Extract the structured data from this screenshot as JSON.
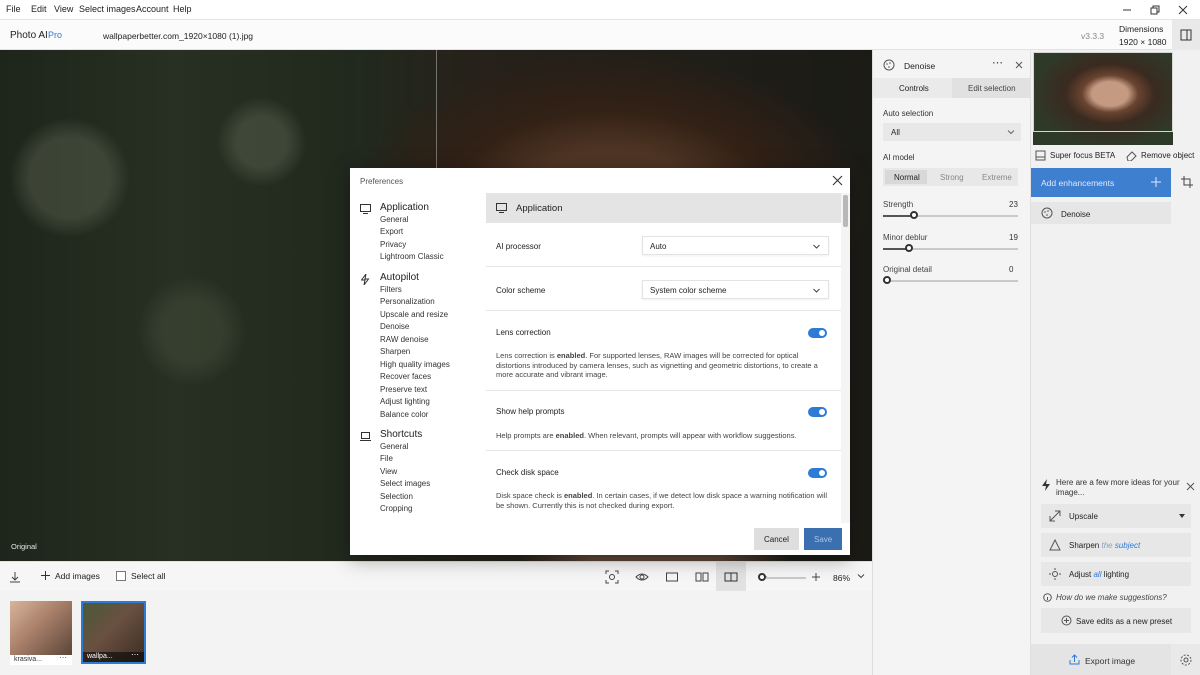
{
  "menu": {
    "file": "File",
    "edit": "Edit",
    "view": "View",
    "select_images": "Select images",
    "account": "Account",
    "help": "Help"
  },
  "header": {
    "app_name": "Photo AI",
    "app_tier": "Pro",
    "file_name": "wallpaperbetter.com_1920×1080 (1).jpg",
    "version": "v3.3.3",
    "dimensions_label": "Dimensions",
    "dimensions_value": "1920 × 1080"
  },
  "canvas": {
    "original_label": "Original"
  },
  "bottombar": {
    "add_images": "Add images",
    "select_all": "Select all",
    "zoom": "86%"
  },
  "filmstrip": {
    "items": [
      {
        "label": "krasiva..."
      },
      {
        "label": "wallpa..."
      }
    ]
  },
  "denoise_panel": {
    "title": "Denoise",
    "tabs": [
      "Controls",
      "Edit selection"
    ],
    "auto_selection_label": "Auto selection",
    "auto_selection_value": "All",
    "ai_model_label": "AI model",
    "models": [
      "Normal",
      "Strong",
      "Extreme"
    ],
    "sliders": [
      {
        "label": "Strength",
        "value": "23",
        "level": 0.23
      },
      {
        "label": "Minor deblur",
        "value": "19",
        "level": 0.19
      },
      {
        "label": "Original detail",
        "value": "0",
        "level": 0.0
      }
    ]
  },
  "side": {
    "super_focus": "Super focus BETA",
    "remove_object": "Remove object",
    "add_enhancements": "Add enhancements",
    "enhancement_item": "Denoise",
    "ideas_text": "Here are a few more ideas for your image...",
    "upscale": "Upscale",
    "sharpen_prefix": "Sharpen",
    "sharpen_the": "the",
    "sharpen_subject": "subject",
    "adjust_prefix": "Adjust",
    "adjust_all": "all",
    "adjust_suffix": "lighting",
    "how_suggestions": "How do we make suggestions?",
    "save_preset": "Save edits as a new preset",
    "export": "Export image"
  },
  "modal": {
    "title": "Preferences",
    "nav": [
      {
        "heading": "Application",
        "items": [
          "General",
          "Export",
          "Privacy",
          "Lightroom Classic"
        ]
      },
      {
        "heading": "Autopilot",
        "items": [
          "Filters",
          "Personalization",
          "Upscale and resize",
          "Denoise",
          "RAW denoise",
          "Sharpen",
          "High quality images",
          "Recover faces",
          "Preserve text",
          "Adjust lighting",
          "Balance color"
        ]
      },
      {
        "heading": "Shortcuts",
        "items": [
          "General",
          "File",
          "View",
          "Select images",
          "Selection",
          "Cropping"
        ]
      }
    ],
    "section_title": "Application",
    "ai_processor_label": "AI processor",
    "ai_processor_value": "Auto",
    "color_scheme_label": "Color scheme",
    "color_scheme_value": "System color scheme",
    "lens": {
      "label": "Lens correction",
      "desc_a": "Lens correction is ",
      "desc_b": "enabled",
      "desc_c": ". For supported lenses, RAW images will be corrected for optical distortions introduced by camera lenses, such as vignetting and geometric distortions, to create a more accurate and vibrant image."
    },
    "help": {
      "label": "Show help prompts",
      "desc_a": "Help prompts are ",
      "desc_b": "enabled",
      "desc_c": ". When relevant, prompts will appear with workflow suggestions."
    },
    "disk": {
      "label": "Check disk space",
      "desc_a": "Disk space check is ",
      "desc_b": "enabled",
      "desc_c": ". In certain cases, if we detect low disk space a warning notification will be shown. Currently this is not checked during export."
    },
    "cancel": "Cancel",
    "save": "Save"
  },
  "colors": {
    "accent": "#2e7bd6",
    "save_button": "#3a6fb0",
    "model_selected": "#d8d8d8"
  }
}
